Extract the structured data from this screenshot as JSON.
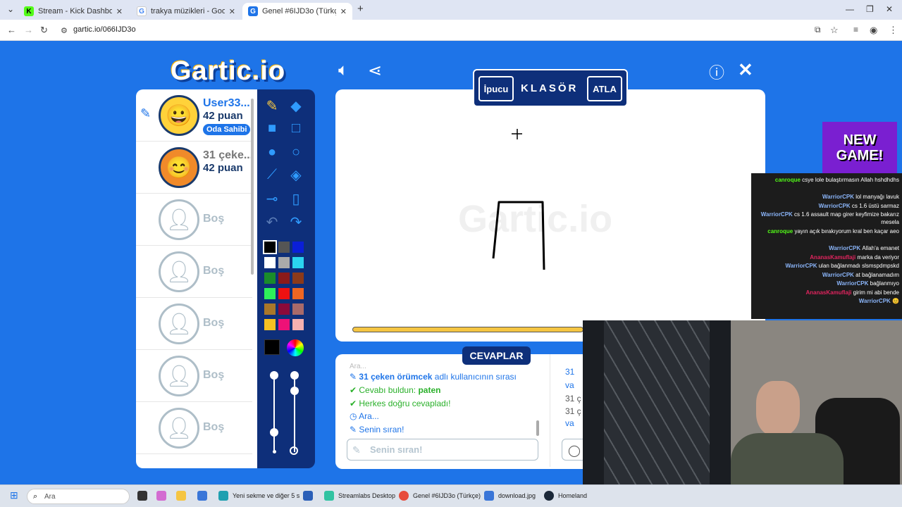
{
  "browser": {
    "tabs": [
      {
        "title": "Stream - Kick Dashboard",
        "favicon_color": "#53fc18",
        "favicon_glyph": "K"
      },
      {
        "title": "trakya müzikleri - Google'da Ar",
        "favicon_color": "#ffffff",
        "favicon_glyph": "G"
      },
      {
        "title": "Genel #6IJD3o (Türkçe) - Gartic",
        "favicon_color": "#1e74e8",
        "favicon_glyph": "G"
      }
    ],
    "new_tab": "+",
    "url": "gartic.io/066IJD3o"
  },
  "game": {
    "logo": "Gartic.io",
    "word_hint_button": "İpucu",
    "word": "KLASÖR",
    "skip_button": "ATLA",
    "watermark": "Gartic.io",
    "players": [
      {
        "name": "User33...",
        "score": "42 puan",
        "badge": "Oda Sahibi",
        "avatar": "😀",
        "drawing": true
      },
      {
        "name": "31 çeke...",
        "score": "42 puan",
        "avatar": "😊"
      },
      {
        "empty": "Boş"
      },
      {
        "empty": "Boş"
      },
      {
        "empty": "Boş"
      },
      {
        "empty": "Boş"
      },
      {
        "empty": "Boş"
      }
    ],
    "answers_title": "CEVAPLAR",
    "answers": [
      {
        "highlight": "31 çeken örümcek",
        "text": " adlı kullanıcının sırası",
        "icon": "pencil-icon"
      },
      {
        "text": "Cevabı buldun: ",
        "highlight": "paten",
        "icon": "check-icon"
      },
      {
        "text": "Herkes doğru cevapladı!",
        "icon": "check-icon"
      },
      {
        "text": "Ara...",
        "icon": "clock-icon"
      },
      {
        "text": "Senin sıran!",
        "icon": "pencil-icon"
      }
    ],
    "answer_placeholder": "Senin sıran!",
    "chat_partial": [
      "31",
      "va",
      "31 ç",
      "31 ç",
      "va"
    ],
    "colors": [
      "#000000",
      "#555555",
      "#0a1fd8",
      "#ffffff",
      "#aaaaaa",
      "#2ad4f0",
      "#1a8c2a",
      "#8b1a1a",
      "#8b3a1a",
      "#2ef05a",
      "#ee1111",
      "#ee6622",
      "#a9772a",
      "#8b0a3a",
      "#a86a6a",
      "#f5c022",
      "#ee1177",
      "#f5b0b0"
    ]
  },
  "stream_chat": [
    {
      "user": "canroque",
      "color": "#53fc18",
      "msg": "csye lole bulaştırmasın Allah hshdhdhs"
    },
    {
      "user": "WarriorCPK",
      "color": "#8ab4f8",
      "msg": "lol manyağı lavuk"
    },
    {
      "user": "WarriorCPK",
      "color": "#8ab4f8",
      "msg": "cs 1.6 üstü sarmaz"
    },
    {
      "user": "WarriorCPK",
      "color": "#8ab4f8",
      "msg": "cs 1.6 assault map girer keyfimize bakarız mesela"
    },
    {
      "user": "canroque",
      "color": "#53fc18",
      "msg": "yayın açık bırakıyorum kral ben kaçar aeo"
    },
    {
      "user": "WarriorCPK",
      "color": "#8ab4f8",
      "msg": "Allah'a emanet"
    },
    {
      "user": "AnanasKamuflaji",
      "color": "#e0245e",
      "msg": "marka da veriyor"
    },
    {
      "user": "WarriorCPK",
      "color": "#8ab4f8",
      "msg": "ulan bağlanmadı slsmspdmpskd"
    },
    {
      "user": "WarriorCPK",
      "color": "#8ab4f8",
      "msg": "at bağlanamadım"
    },
    {
      "user": "WarriorCPK",
      "color": "#8ab4f8",
      "msg": "bağlanmıyo"
    },
    {
      "user": "AnanasKamuflaji",
      "color": "#e0245e",
      "msg": "girim mi abi bende"
    },
    {
      "user": "WarriorCPK",
      "color": "#8ab4f8",
      "msg": "😊"
    }
  ],
  "ad": {
    "line1": "NEW",
    "line2": "GAME!"
  },
  "taskbar": {
    "search": "Ara",
    "items": [
      "Yeni sekme ve diğer 5 s",
      "Streamlabs Desktop",
      "Genel #6IJD3o (Türkçe)",
      "download.jpg",
      "Homeland"
    ]
  }
}
